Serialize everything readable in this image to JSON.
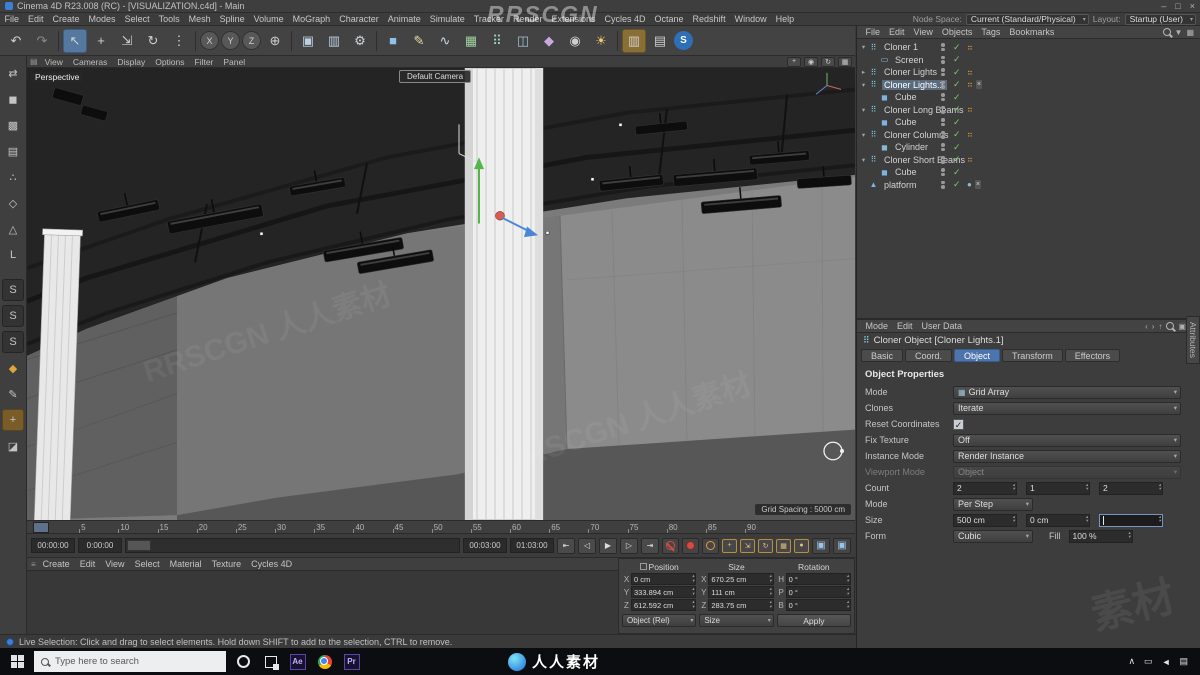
{
  "watermarks": {
    "top": "RRSCGN",
    "diagonal": "RRSCGN 人人素材",
    "corner": "素材",
    "taskbar": "人人素材"
  },
  "window": {
    "title": "Cinema 4D R23.008 (RC) - [VISUALIZATION.c4d] - Main",
    "minimize": "–",
    "maximize": "□",
    "close": "×"
  },
  "menu_bar": {
    "items": [
      "File",
      "Edit",
      "Create",
      "Modes",
      "Select",
      "Tools",
      "Mesh",
      "Spline",
      "Volume",
      "MoGraph",
      "Character",
      "Animate",
      "Simulate",
      "Tracker",
      "Render",
      "Extensions",
      "Cycles 4D",
      "Octane",
      "Redshift",
      "Window",
      "Help"
    ],
    "node_space_label": "Node Space:",
    "node_space_value": "Current (Standard/Physical)",
    "layout_label": "Layout:",
    "layout_value": "Startup (User)"
  },
  "toolbar": {
    "icons": [
      {
        "name": "undo-icon",
        "glyph": "↶"
      },
      {
        "name": "redo-icon",
        "glyph": "↷",
        "dim": true
      },
      {
        "sep": true
      },
      {
        "name": "live-selection-tool",
        "glyph": "↖",
        "selected": true
      },
      {
        "name": "move-tool",
        "glyph": "+"
      },
      {
        "name": "scale-tool",
        "glyph": "⇲"
      },
      {
        "name": "rotate-tool",
        "glyph": "↻"
      },
      {
        "name": "last-used-tools",
        "glyph": "⋮"
      },
      {
        "sep": true
      },
      {
        "name": "lock-x-axis",
        "glyph": "X",
        "pill": true
      },
      {
        "name": "lock-y-axis",
        "glyph": "Y",
        "pill": true
      },
      {
        "name": "lock-z-axis",
        "glyph": "Z",
        "pill": true
      },
      {
        "name": "coordinate-system",
        "glyph": "⊕"
      },
      {
        "sep": true
      },
      {
        "name": "render-view-button",
        "glyph": "▣",
        "color": "#bcd0e4"
      },
      {
        "name": "render-picture-viewer-button",
        "glyph": "▥",
        "color": "#bcd0e4"
      },
      {
        "name": "render-settings-button",
        "glyph": "⚙",
        "color": "#cfd4da"
      },
      {
        "sep": true
      },
      {
        "name": "add-cube-object",
        "glyph": "■",
        "color": "#8fc1ec"
      },
      {
        "name": "pen-tool",
        "glyph": "✎",
        "color": "#e4d9a8"
      },
      {
        "name": "spline-tool",
        "glyph": "∿",
        "color": "#cbd6e2"
      },
      {
        "name": "subdivision-surface-object",
        "glyph": "▦",
        "color": "#9fd49f"
      },
      {
        "name": "mograph-cloner-object",
        "glyph": "⠿",
        "color": "#9fd4c8"
      },
      {
        "name": "array-object",
        "glyph": "◫",
        "color": "#9fc0d4"
      },
      {
        "name": "deformer-object",
        "glyph": "◆",
        "color": "#c9a8e0"
      },
      {
        "name": "camera-object",
        "glyph": "◉",
        "color": "#cfcfcf"
      },
      {
        "name": "light-object",
        "glyph": "☀",
        "color": "#f0d070"
      },
      {
        "sep": true
      },
      {
        "name": "snap-settings",
        "glyph": "▥",
        "gold": true
      },
      {
        "name": "workplane-icon",
        "glyph": "▤"
      },
      {
        "name": "cycles-4d-badge",
        "glyph": "S",
        "circle": true
      }
    ]
  },
  "left_toolbar": {
    "icons": [
      {
        "name": "make-editable-icon",
        "glyph": "⇄"
      },
      {
        "name": "model-mode-icon",
        "glyph": "◼"
      },
      {
        "name": "texture-mode-icon",
        "glyph": "▩"
      },
      {
        "name": "workplane-mode-icon",
        "glyph": "▤"
      },
      {
        "name": "points-mode-icon",
        "glyph": "∴"
      },
      {
        "name": "edges-mode-icon",
        "glyph": "◇"
      },
      {
        "name": "polygons-mode-icon",
        "glyph": "△"
      },
      {
        "name": "object-axis-icon",
        "glyph": "L"
      },
      {
        "gap": true
      },
      {
        "name": "snap-1-icon",
        "glyph": "S",
        "tile": true
      },
      {
        "name": "snap-2-icon",
        "glyph": "S",
        "tile": true
      },
      {
        "name": "snap-3-icon",
        "glyph": "S",
        "tile": true
      },
      {
        "name": "enable-snap-icon",
        "glyph": "◆",
        "gold": true
      },
      {
        "name": "brush-icon",
        "glyph": "✎"
      },
      {
        "name": "modeling-settings-icon",
        "glyph": "+",
        "goldbg": true
      },
      {
        "name": "mirror-icon",
        "glyph": "◪"
      }
    ]
  },
  "viewport": {
    "menu": [
      "View",
      "Cameras",
      "Display",
      "Options",
      "Filter",
      "Panel"
    ],
    "view_controls": [
      {
        "name": "pan-view-icon",
        "glyph": "+"
      },
      {
        "name": "zoom-view-icon",
        "glyph": "◉"
      },
      {
        "name": "rotate-view-icon",
        "glyph": "↻"
      },
      {
        "name": "toggle-layout-icon",
        "glyph": "▦"
      }
    ],
    "view_label": "Perspective",
    "camera_label": "Default Camera",
    "grid_spacing": "Grid Spacing : 5000 cm"
  },
  "ruler": {
    "numbers": [
      "0",
      "5",
      "10",
      "15",
      "20",
      "25",
      "30",
      "35",
      "40",
      "45",
      "50",
      "55",
      "60",
      "65",
      "70",
      "75",
      "80",
      "85",
      "90"
    ]
  },
  "anim": {
    "fields_left": [
      "00:00:00",
      "0:00:00"
    ],
    "fields_right": [
      "00:03:00",
      "01:03:00"
    ],
    "transport": [
      {
        "name": "go-to-start-button",
        "glyph": "⇤"
      },
      {
        "name": "previous-frame-button",
        "glyph": "◁"
      },
      {
        "name": "play-button",
        "glyph": "▶"
      },
      {
        "name": "next-frame-button",
        "glyph": "▷"
      },
      {
        "name": "go-to-end-button",
        "glyph": "⇥"
      }
    ],
    "record_buttons": [
      {
        "name": "record-keyframe-button",
        "style": "red-slash"
      },
      {
        "name": "autokey-button",
        "style": "red"
      },
      {
        "name": "record-selection-button",
        "style": "orange"
      }
    ],
    "key_filters": [
      {
        "name": "key-position-button",
        "glyph": "+"
      },
      {
        "name": "key-scale-button",
        "glyph": "⇲"
      },
      {
        "name": "key-rotation-button",
        "glyph": "↻"
      },
      {
        "name": "key-parameter-button",
        "glyph": "▦"
      },
      {
        "name": "key-pla-button",
        "glyph": "●"
      }
    ],
    "end_icons": [
      {
        "name": "preview-range-button",
        "glyph": "▣"
      },
      {
        "name": "sound-scrub-button",
        "glyph": "▣"
      }
    ]
  },
  "materials_menu": {
    "items": [
      "Create",
      "Edit",
      "View",
      "Select",
      "Material",
      "Texture",
      "Cycles 4D"
    ]
  },
  "coords": {
    "groups": [
      {
        "header": "Position",
        "icon": true,
        "axes": [
          "X",
          "Y",
          "Z"
        ],
        "values": [
          "0 cm",
          "333.894 cm",
          "612.592 cm"
        ]
      },
      {
        "header": "Size",
        "axes": [
          "X",
          "Y",
          "Z"
        ],
        "values": [
          "670.25 cm",
          "111 cm",
          "283.75 cm"
        ]
      },
      {
        "header": "Rotation",
        "axes": [
          "H",
          "P",
          "B"
        ],
        "values": [
          "0 °",
          "0 °",
          "0 °"
        ]
      }
    ],
    "mode_value": "Object (Rel)",
    "size_mode_value": "Size",
    "apply_label": "Apply"
  },
  "status": {
    "text": "Live Selection: Click and drag to select elements. Hold down SHIFT to add to the selection, CTRL to remove."
  },
  "object_manager": {
    "menu": [
      "File",
      "Edit",
      "View",
      "Objects",
      "Tags",
      "Bookmarks"
    ],
    "menu_icons": [
      {
        "name": "om-search-icon",
        "glyph": "mag"
      },
      {
        "name": "om-filter-icon",
        "glyph": "▼"
      },
      {
        "name": "om-view-icon",
        "glyph": "▦"
      }
    ],
    "items": [
      {
        "indent": 0,
        "name": "Cloner 1",
        "icon": "cloner",
        "arrow": "▾",
        "tags": [
          "mograph"
        ]
      },
      {
        "indent": 1,
        "name": "Screen",
        "icon": "plane"
      },
      {
        "indent": 0,
        "name": "Cloner Lights",
        "icon": "cloner",
        "arrow": "▸",
        "tags": [
          "mograph"
        ]
      },
      {
        "indent": 0,
        "name": "Cloner Lights.1",
        "icon": "cloner",
        "arrow": "▾",
        "selected": true,
        "tags": [
          "mograph",
          "cross"
        ]
      },
      {
        "indent": 1,
        "name": "Cube",
        "icon": "cube"
      },
      {
        "indent": 0,
        "name": "Cloner Long Beams",
        "icon": "cloner",
        "arrow": "▾",
        "tags": [
          "mograph"
        ]
      },
      {
        "indent": 1,
        "name": "Cube",
        "icon": "cube"
      },
      {
        "indent": 0,
        "name": "Cloner Columns",
        "icon": "cloner",
        "arrow": "▾",
        "tags": [
          "mograph"
        ]
      },
      {
        "indent": 1,
        "name": "Cylinder",
        "icon": "cylinder"
      },
      {
        "indent": 0,
        "name": "Cloner Short Beams",
        "icon": "cloner",
        "arrow": "▾",
        "tags": [
          "mograph"
        ]
      },
      {
        "indent": 1,
        "name": "Cube",
        "icon": "cube"
      },
      {
        "indent": 0,
        "name": "platform",
        "icon": "polygon",
        "tags": [
          "phong",
          "cross"
        ]
      }
    ]
  },
  "attribute_manager": {
    "menu": [
      "Mode",
      "Edit",
      "User Data"
    ],
    "menu_icons": [
      {
        "name": "am-back-icon",
        "glyph": "‹"
      },
      {
        "name": "am-forward-icon",
        "glyph": "›"
      },
      {
        "name": "am-up-icon",
        "glyph": "↑"
      },
      {
        "name": "am-search-icon",
        "glyph": "mag"
      },
      {
        "name": "am-lock-icon",
        "glyph": "▣"
      },
      {
        "name": "am-settings-icon",
        "glyph": "▾"
      }
    ],
    "title": "Cloner Object [Cloner Lights.1]",
    "tabs": [
      {
        "label": "Basic"
      },
      {
        "label": "Coord."
      },
      {
        "label": "Object",
        "active": true
      },
      {
        "label": "Transform"
      },
      {
        "label": "Effectors"
      }
    ],
    "section": "Object Properties",
    "rows": [
      {
        "type": "dropdown",
        "label": "Mode",
        "value": "Grid Array",
        "icon": "▦"
      },
      {
        "type": "dropdown",
        "label": "Clones",
        "value": "Iterate"
      },
      {
        "type": "checkbox",
        "label": "Reset Coordinates",
        "checked": true
      },
      {
        "type": "dropdown",
        "label": "Fix Texture",
        "value": "Off"
      },
      {
        "type": "dropdown",
        "label": "Instance Mode",
        "value": "Render Instance"
      },
      {
        "type": "dropdown",
        "label": "Viewport Mode",
        "value": "Object",
        "disabled": true
      },
      {
        "type": "numbers",
        "label": "Count",
        "values": [
          "2",
          "1",
          "2"
        ]
      },
      {
        "type": "dropdown",
        "label": "Mode",
        "value": "Per Step",
        "small": true
      },
      {
        "type": "numbers",
        "label": "Size",
        "values": [
          "500 cm",
          "0 cm",
          ""
        ],
        "focused": 2
      },
      {
        "type": "pair",
        "label": "Form",
        "value": "Cubic",
        "label2": "Fill",
        "value2": "100 %"
      }
    ]
  },
  "side_tab": {
    "label": "Attributes"
  },
  "taskbar": {
    "search_placeholder": "Type here to search",
    "apps": [
      {
        "name": "cortana-icon",
        "kind": "cortana"
      },
      {
        "name": "task-view-icon",
        "kind": "taskview"
      },
      {
        "name": "after-effects-icon",
        "kind": "badge",
        "label": "Ae"
      },
      {
        "name": "chrome-icon",
        "kind": "chrome"
      },
      {
        "name": "premiere-icon",
        "kind": "badge",
        "label": "Pr"
      }
    ],
    "tray": [
      {
        "name": "tray-chevron-icon",
        "glyph": "∧"
      },
      {
        "name": "tray-display-icon",
        "glyph": "▭"
      },
      {
        "name": "tray-volume-icon",
        "glyph": "◄"
      },
      {
        "name": "tray-message-icon",
        "glyph": "▤"
      }
    ]
  }
}
